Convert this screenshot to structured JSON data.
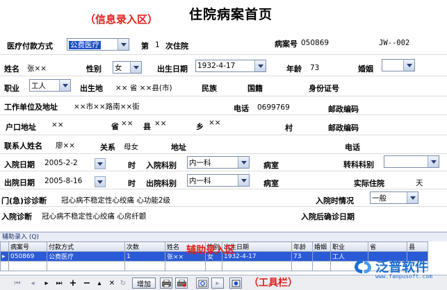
{
  "annotations": {
    "info_area": "（信息录入区）",
    "aux_area": "辅助录入区",
    "toolbar_area": "（工具栏）"
  },
  "title": "住院病案首页",
  "row1": {
    "payment_label": "医疗付款方式",
    "payment_value": "公费医疗",
    "visit_prefix": "第",
    "visit_num": "1",
    "visit_suffix": "次住院",
    "case_label": "病案号",
    "case_value": "050869",
    "code": "JW--002"
  },
  "row2": {
    "name_label": "姓名",
    "name_value": "张××",
    "sex_label": "性别",
    "sex_value": "女",
    "birth_label": "出生日期",
    "birth_value": "1932-4-17",
    "age_label": "年龄",
    "age_value": "73",
    "marriage_label": "婚姻",
    "marriage_value": ""
  },
  "row3": {
    "job_label": "职业",
    "job_value": "工人",
    "birthplace_label": "出生地",
    "birthplace_value": "××  省 ××县(市)",
    "nation_label": "民族",
    "country_label": "国籍",
    "id_label": "身份证号"
  },
  "row4": {
    "work_label": "工作单位及地址",
    "work_value": "××市××路南××街",
    "phone_label": "电话",
    "phone_value": "0699769",
    "zip_label": "邮政编码"
  },
  "row5": {
    "hukou_label": "户口地址",
    "hukou_v1": "××",
    "sheng_label": "省",
    "sheng_value": "××",
    "xian_label": "县",
    "xian_value": "××",
    "xiang_label": "乡",
    "xiang_value": "××",
    "cun_label": "村",
    "zip_label": "邮政编码"
  },
  "row6": {
    "contact_label": "联系人姓名",
    "contact_value": "廖××",
    "relation_label": "关系",
    "relation_value": "母女",
    "address_label": "地址",
    "phone_label": "电话"
  },
  "row7": {
    "in_date_label": "入院日期",
    "in_date_value": "2005-2-2",
    "hour_label": "时",
    "dept_label": "入院科别",
    "dept_value": "内一科",
    "ward_label": "病室",
    "transfer_label": "转科科别",
    "transfer_value": ""
  },
  "row8": {
    "out_date_label": "出院日期",
    "out_date_value": "2005-8-16",
    "hour_label": "时",
    "dept_label": "出院科别",
    "dept_value": "内一科",
    "ward_label": "病室",
    "actual_label": "实际住院",
    "actual_unit": "天"
  },
  "row9": {
    "diag_label": "门(急)诊诊断",
    "diag_value": "冠心病不稳定性心绞痛 心功能2级",
    "condition_label": "入院时情况",
    "condition_value": "一般"
  },
  "row10": {
    "diag_label": "入院诊断",
    "diag_value": "冠心病不稳定性心绞痛 心房纤颤",
    "confirm_label": "入院后确诊日期"
  },
  "grid": {
    "title": "辅助录入 (Q)",
    "columns": [
      "病案号",
      "付款方式",
      "次数",
      "姓名",
      "性别",
      "出生日期",
      "年龄",
      "婚姻",
      "职业",
      "省",
      "县"
    ],
    "rows": [
      [
        "050869",
        "公费医疗",
        "1",
        "张××",
        "女",
        "1932-4-17",
        "73",
        "",
        "工人",
        "",
        ""
      ]
    ]
  },
  "toolbar": {
    "add_label": "增加"
  },
  "logo": {
    "name": "泛普软件",
    "url": "www.fanpusoft.com"
  },
  "colors": {
    "accent_red": "#e0201a",
    "selection_blue": "#2a5ad6",
    "logo_blue": "#1c6ed2"
  }
}
